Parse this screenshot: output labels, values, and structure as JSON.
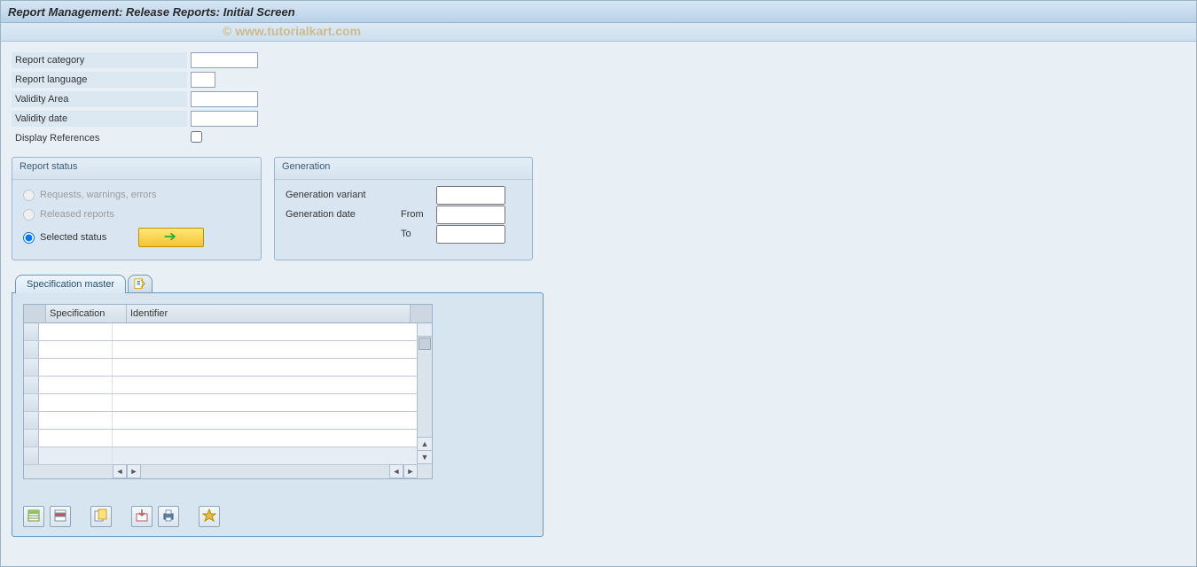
{
  "title": "Report Management: Release Reports: Initial Screen",
  "watermark": "© www.tutorialkart.com",
  "form": {
    "report_category_label": "Report category",
    "report_category_value": "",
    "report_language_label": "Report language",
    "report_language_value": "",
    "validity_area_label": "Validity Area",
    "validity_area_value": "",
    "validity_date_label": "Validity date",
    "validity_date_value": "",
    "display_refs_label": "Display References",
    "display_refs_checked": false
  },
  "status_group": {
    "title": "Report status",
    "opt_requests": "Requests, warnings, errors",
    "opt_released": "Released reports",
    "opt_selected": "Selected status"
  },
  "generation_group": {
    "title": "Generation",
    "variant_label": "Generation variant",
    "variant_value": "",
    "date_label": "Generation date",
    "from_label": "From",
    "from_value": "",
    "to_label": "To",
    "to_value": ""
  },
  "tabs": {
    "spec_master": "Specification master"
  },
  "grid": {
    "col_spec": "Specification",
    "col_id": "Identifier",
    "rows": [
      {
        "spec": "",
        "id": ""
      },
      {
        "spec": "",
        "id": ""
      },
      {
        "spec": "",
        "id": ""
      },
      {
        "spec": "",
        "id": ""
      },
      {
        "spec": "",
        "id": ""
      },
      {
        "spec": "",
        "id": ""
      },
      {
        "spec": "",
        "id": ""
      }
    ]
  },
  "toolbar_icons": {
    "add_row": "add-row-icon",
    "delete_row": "delete-row-icon",
    "copy_row": "copy-row-icon",
    "export": "export-icon",
    "print": "print-icon",
    "configure": "configure-icon"
  }
}
